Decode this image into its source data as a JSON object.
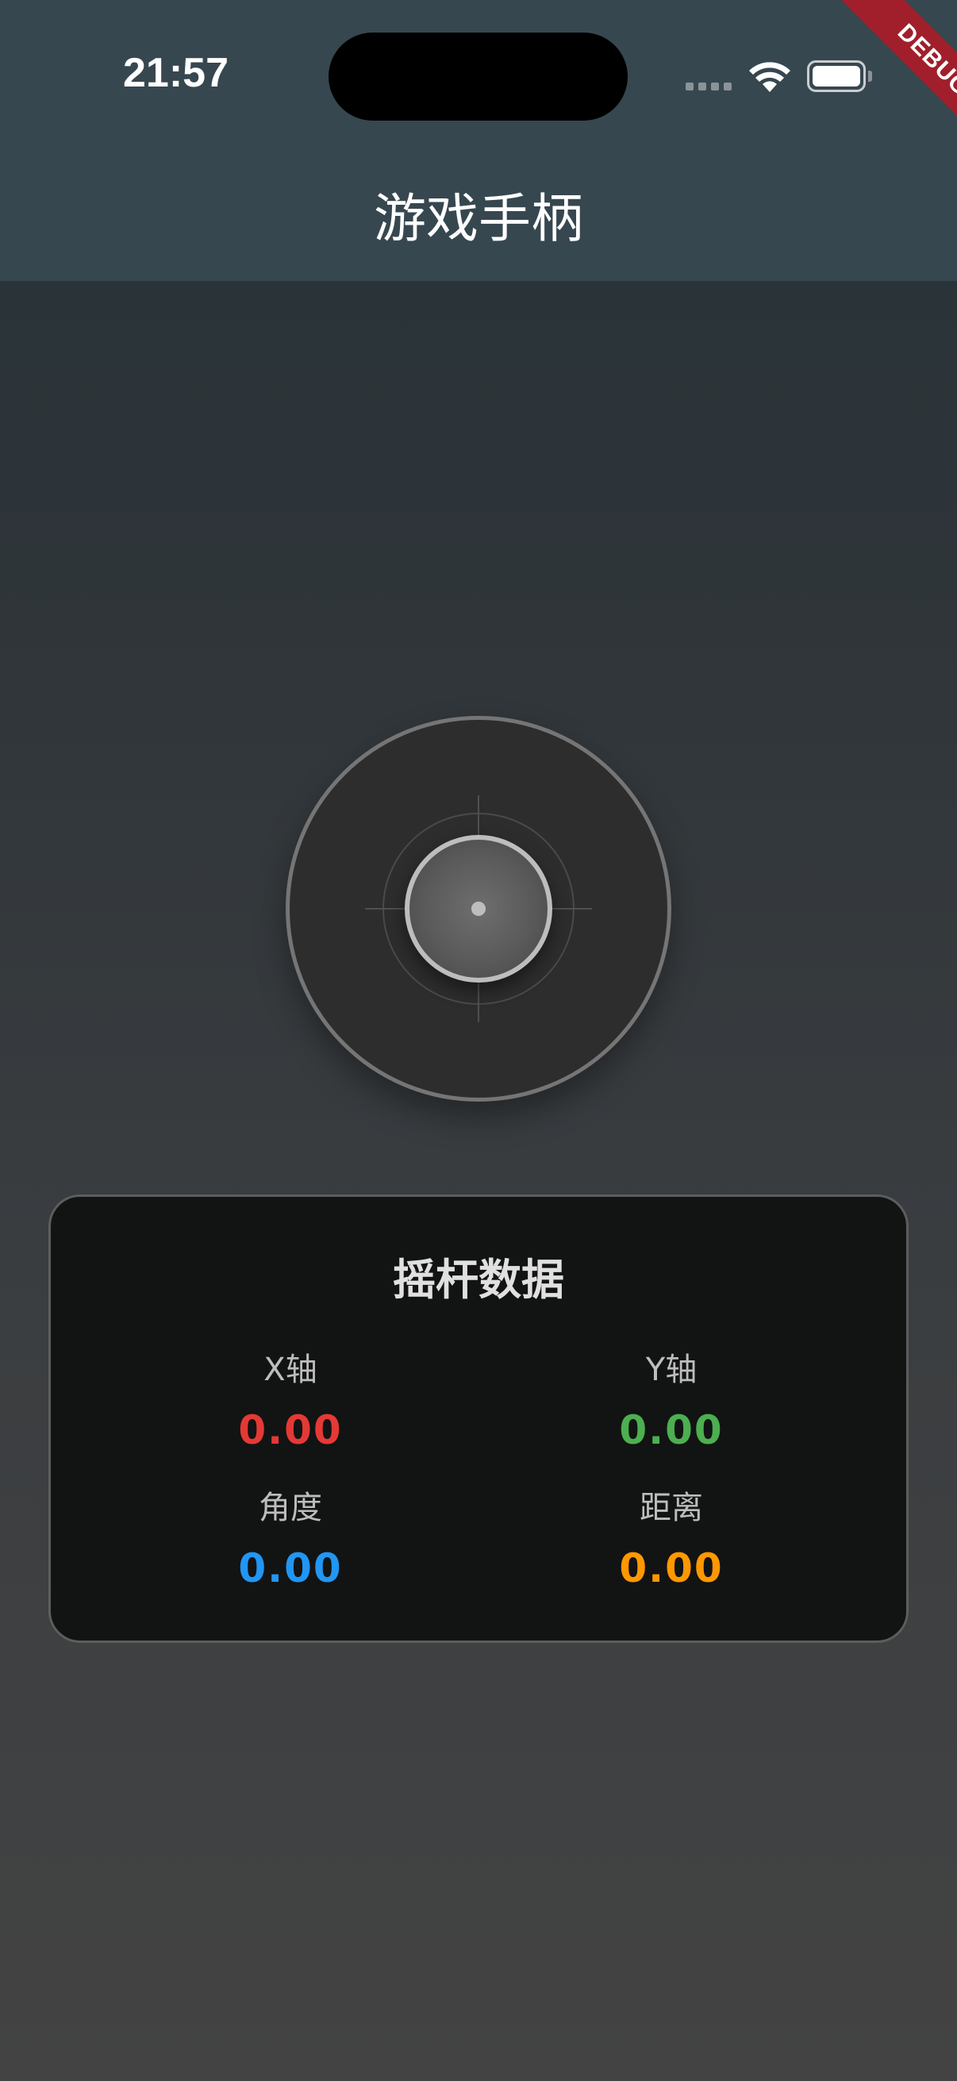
{
  "status_bar": {
    "time": "21:57"
  },
  "debug_banner": {
    "label": "DEBUG"
  },
  "app_bar": {
    "title": "游戏手柄"
  },
  "joystick": {
    "x": 0.0,
    "y": 0.0
  },
  "data_panel": {
    "title": "摇杆数据",
    "metrics": [
      {
        "label": "X轴",
        "value": "0.00",
        "color": "#e53935"
      },
      {
        "label": "Y轴",
        "value": "0.00",
        "color": "#4caf50"
      },
      {
        "label": "角度",
        "value": "0.00",
        "color": "#2196f3"
      },
      {
        "label": "距离",
        "value": "0.00",
        "color": "#ff9800"
      }
    ]
  },
  "colors": {
    "app_bar_background": "#37474f",
    "panel_background": "#121313",
    "debug_ribbon": "#a01f2b"
  }
}
